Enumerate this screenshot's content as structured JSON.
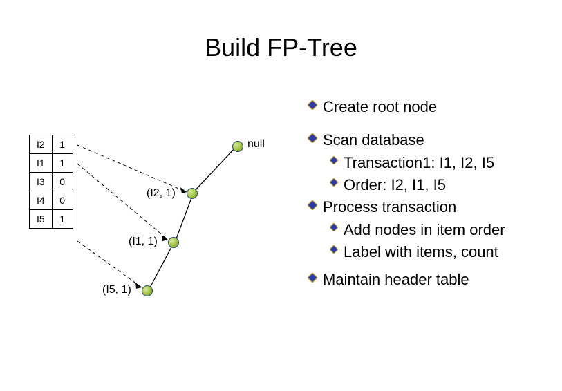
{
  "title": "Build FP-Tree",
  "header_table": {
    "rows": [
      {
        "item": "I2",
        "count": "1"
      },
      {
        "item": "I1",
        "count": "1"
      },
      {
        "item": "I3",
        "count": "0"
      },
      {
        "item": "I4",
        "count": "0"
      },
      {
        "item": "I5",
        "count": "1"
      }
    ]
  },
  "tree": {
    "root_label": "null",
    "nodes": [
      {
        "label": "(I2, 1)"
      },
      {
        "label": "(I1, 1)"
      },
      {
        "label": "(I5, 1)"
      }
    ]
  },
  "bullets": {
    "b0": "Create root node",
    "b1": "Scan database",
    "b1a": "Transaction1: I1, I2, I5",
    "b1b": "Order: I2, I1, I5",
    "b2": "Process transaction",
    "b2a": "Add nodes in item order",
    "b2b": "Label with items, count",
    "b3": "Maintain header table"
  }
}
